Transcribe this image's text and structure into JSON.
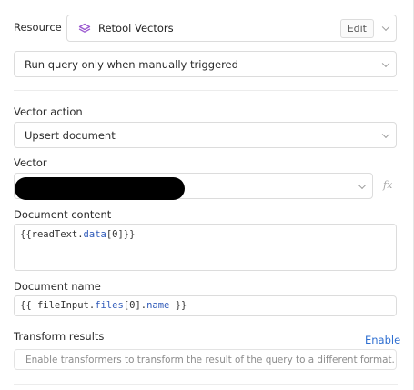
{
  "resource": {
    "label": "Resource",
    "value": "Retool Vectors",
    "edit_label": "Edit",
    "icon": "layers-icon",
    "icon_color": "#9b59d0"
  },
  "trigger": {
    "value": "Run query only when manually triggered"
  },
  "vector_action": {
    "label": "Vector action",
    "value": "Upsert document"
  },
  "vector": {
    "label": "Vector",
    "value": ""
  },
  "document_content": {
    "label": "Document content",
    "code": "{{readText.data[0]}}",
    "code_parts": [
      "{{readText.",
      "data",
      "[0]}}"
    ]
  },
  "document_name": {
    "label": "Document name",
    "code": "{{ fileInput.files[0].name }}",
    "code_parts": [
      "{{ fileInput.",
      "files",
      "[0].",
      "name",
      " }}"
    ]
  },
  "transform": {
    "label": "Transform results",
    "enable_label": "Enable",
    "placeholder": "Enable transformers to transform the result of the query to a different format."
  },
  "colors": {
    "link": "#2f6fd1",
    "border": "#dcdcdc",
    "code_keyword": "#2f5ab9"
  }
}
